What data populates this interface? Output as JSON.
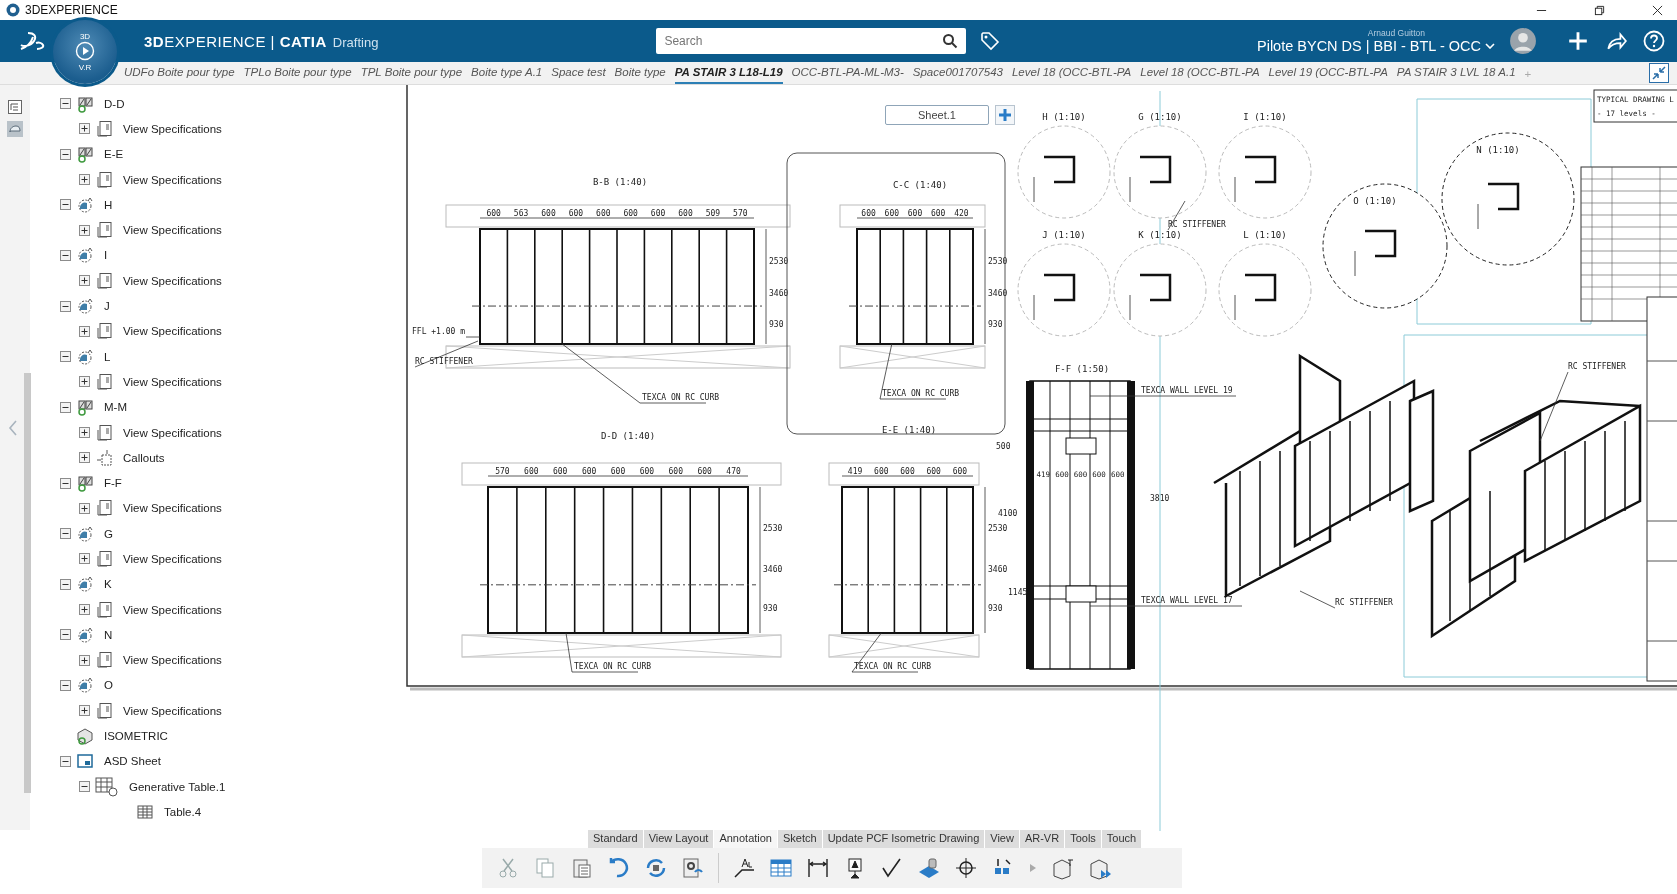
{
  "window": {
    "title": "3DEXPERIENCE"
  },
  "header": {
    "compass_top": "3D",
    "compass_bottom": "V.R",
    "brand": "**3D**EXPERIENCE | **CATIA**",
    "app": "Drafting",
    "search": {
      "placeholder": "Search"
    },
    "user": "Arnaud Guitton",
    "context": "Pilote BYCN DS | BBI - BTL - OCC"
  },
  "tabs": [
    {
      "label": "UDFo Boite pour type",
      "selected": false
    },
    {
      "label": "TPLo Boite pour type",
      "selected": false
    },
    {
      "label": "TPL Boite pour type",
      "selected": false
    },
    {
      "label": "Boite type A.1",
      "selected": false
    },
    {
      "label": "Space test",
      "selected": false
    },
    {
      "label": "Boite type",
      "selected": false
    },
    {
      "label": "PA STAIR 3 L18-L19",
      "selected": true
    },
    {
      "label": "OCC-BTL-PA-ML-M3-",
      "selected": false
    },
    {
      "label": "Space001707543",
      "selected": false
    },
    {
      "label": "Level 18 (OCC-BTL-PA",
      "selected": false
    },
    {
      "label": "Level 18 (OCC-BTL-PA",
      "selected": false
    },
    {
      "label": "Level 19 (OCC-BTL-PA",
      "selected": false
    },
    {
      "label": "PA STAIR 3 LVL 18 A.1",
      "selected": false
    }
  ],
  "new_tab": "+",
  "tree": [
    {
      "label": "D-D",
      "kind": "section",
      "expanded": true,
      "children": [
        {
          "label": "View Specifications",
          "kind": "specs",
          "expanded": false
        }
      ]
    },
    {
      "label": "E-E",
      "kind": "section",
      "expanded": true,
      "children": [
        {
          "label": "View Specifications",
          "kind": "specs",
          "expanded": false
        }
      ]
    },
    {
      "label": "H",
      "kind": "detail",
      "expanded": true,
      "children": [
        {
          "label": "View Specifications",
          "kind": "specs",
          "expanded": false
        }
      ]
    },
    {
      "label": "I",
      "kind": "detail",
      "expanded": true,
      "children": [
        {
          "label": "View Specifications",
          "kind": "specs",
          "expanded": false
        }
      ]
    },
    {
      "label": "J",
      "kind": "detail",
      "expanded": true,
      "children": [
        {
          "label": "View Specifications",
          "kind": "specs",
          "expanded": false
        }
      ]
    },
    {
      "label": "L",
      "kind": "detail",
      "expanded": true,
      "children": [
        {
          "label": "View Specifications",
          "kind": "specs",
          "expanded": false
        }
      ]
    },
    {
      "label": "M-M",
      "kind": "section",
      "expanded": true,
      "children": [
        {
          "label": "View Specifications",
          "kind": "specs",
          "expanded": false
        },
        {
          "label": "Callouts",
          "kind": "callouts",
          "expanded": false
        }
      ]
    },
    {
      "label": "F-F",
      "kind": "section",
      "expanded": true,
      "children": [
        {
          "label": "View Specifications",
          "kind": "specs",
          "expanded": false
        }
      ]
    },
    {
      "label": "G",
      "kind": "detail",
      "expanded": true,
      "children": [
        {
          "label": "View Specifications",
          "kind": "specs",
          "expanded": false
        }
      ]
    },
    {
      "label": "K",
      "kind": "detail",
      "expanded": true,
      "children": [
        {
          "label": "View Specifications",
          "kind": "specs",
          "expanded": false
        }
      ]
    },
    {
      "label": "N",
      "kind": "detail",
      "expanded": true,
      "children": [
        {
          "label": "View Specifications",
          "kind": "specs",
          "expanded": false
        }
      ]
    },
    {
      "label": "O",
      "kind": "detail",
      "expanded": true,
      "children": [
        {
          "label": "View Specifications",
          "kind": "specs",
          "expanded": false
        }
      ]
    },
    {
      "label": "ISOMETRIC",
      "kind": "isometric"
    },
    {
      "label": "ASD Sheet",
      "kind": "sheet",
      "expanded": true,
      "children": [
        {
          "label": "Generative Table.1",
          "kind": "gentable",
          "expanded": true,
          "children": [
            {
              "label": "Table.4",
              "kind": "table"
            }
          ]
        }
      ]
    }
  ],
  "sheet": {
    "name": "Sheet.1",
    "elevations": [
      {
        "title": "B-B (1:40)",
        "dims": [
          "600",
          "563",
          "600",
          "600",
          "600",
          "600",
          "600",
          "600",
          "509",
          "570"
        ],
        "heights": [
          "2530",
          "3460",
          "930"
        ],
        "note": "TEXCA ON RC CURB"
      },
      {
        "title": "C-C (1:40)",
        "dims": [
          "600",
          "600",
          "600",
          "600",
          "420"
        ],
        "heights": [
          "2530",
          "3460",
          "930"
        ],
        "note": "TEXCA ON RC CURB"
      },
      {
        "title": "D-D (1:40)",
        "dims": [
          "570",
          "600",
          "600",
          "600",
          "600",
          "600",
          "600",
          "600",
          "470"
        ],
        "heights": [
          "2530",
          "3460",
          "930"
        ],
        "note": "TEXCA ON RC CURB"
      },
      {
        "title": "E-E (1:40)",
        "dims": [
          "419",
          "600",
          "600",
          "600",
          "600"
        ],
        "heights": [
          "2530",
          "3460",
          "930"
        ],
        "note": "TEXCA ON RC CURB"
      }
    ],
    "plan": {
      "title": "F-F (1:50)",
      "dims": [
        "419",
        "600",
        "600",
        "600",
        "600"
      ],
      "heights": [
        "3810",
        "1145",
        "4100",
        "500"
      ],
      "notes": [
        "TEXCA WALL LEVEL 19",
        "TEXCA WALL LEVEL 17"
      ]
    },
    "details": [
      "H (1:10)",
      "G (1:10)",
      "I (1:10)",
      "J (1:10)",
      "K (1:10)",
      "L (1:10)",
      "O (1:10)",
      "N (1:10)"
    ],
    "labels": [
      "RC STIFFENER",
      "RC STIFFENER",
      "RC STIFFENER",
      "RC STIFFENER",
      "FFL +1.00 m"
    ],
    "title_box": [
      "TYPICAL DRAWING L",
      "- 17 levels -"
    ]
  },
  "toolbar_tabs": [
    {
      "label": "Standard",
      "selected": false
    },
    {
      "label": "View Layout",
      "selected": false
    },
    {
      "label": "Annotation",
      "selected": true
    },
    {
      "label": "Sketch",
      "selected": false
    },
    {
      "label": "Update PCF Isometric Drawing",
      "selected": false
    },
    {
      "label": "View",
      "selected": false
    },
    {
      "label": "AR-VR",
      "selected": false
    },
    {
      "label": "Tools",
      "selected": false
    },
    {
      "label": "Touch",
      "selected": false
    }
  ]
}
